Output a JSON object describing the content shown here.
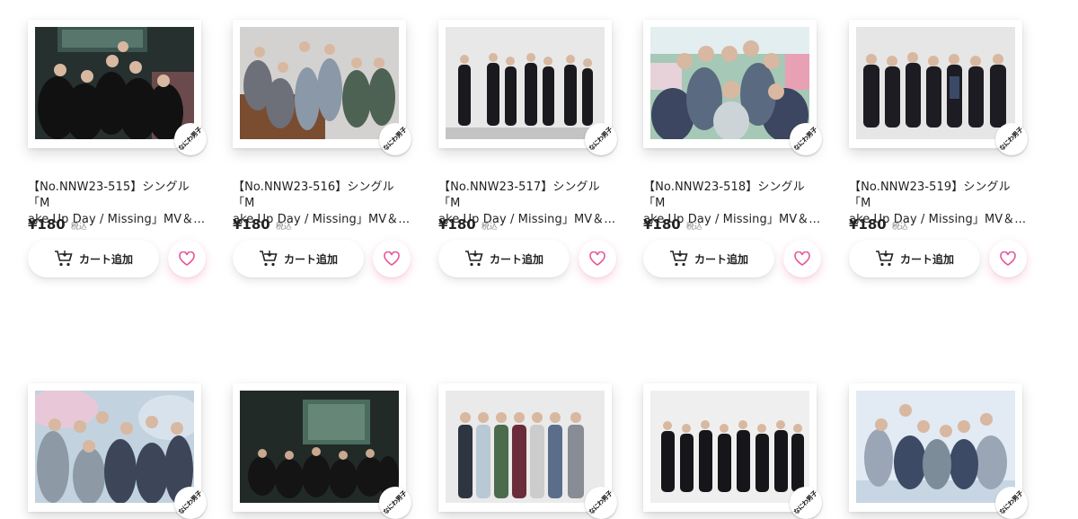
{
  "colors": {
    "accent": "#e8559a",
    "text": "#222222",
    "muted": "#888888"
  },
  "badge_text": "なにわ男子",
  "row1": [
    {
      "title_line1": "【No.NNW23-515】シングル「M",
      "title_line2": "ake Up Day / Missing」MV＆...",
      "price": "¥180",
      "tax": "税込",
      "cart_label": "カート追加"
    },
    {
      "title_line1": "【No.NNW23-516】シングル「M",
      "title_line2": "ake Up Day / Missing」MV＆...",
      "price": "¥180",
      "tax": "税込",
      "cart_label": "カート追加"
    },
    {
      "title_line1": "【No.NNW23-517】シングル「M",
      "title_line2": "ake Up Day / Missing」MV＆...",
      "price": "¥180",
      "tax": "税込",
      "cart_label": "カート追加"
    },
    {
      "title_line1": "【No.NNW23-518】シングル「M",
      "title_line2": "ake Up Day / Missing」MV＆...",
      "price": "¥180",
      "tax": "税込",
      "cart_label": "カート追加"
    },
    {
      "title_line1": "【No.NNW23-519】シングル「M",
      "title_line2": "ake Up Day / Missing」MV＆...",
      "price": "¥180",
      "tax": "税込",
      "cart_label": "カート追加"
    }
  ]
}
